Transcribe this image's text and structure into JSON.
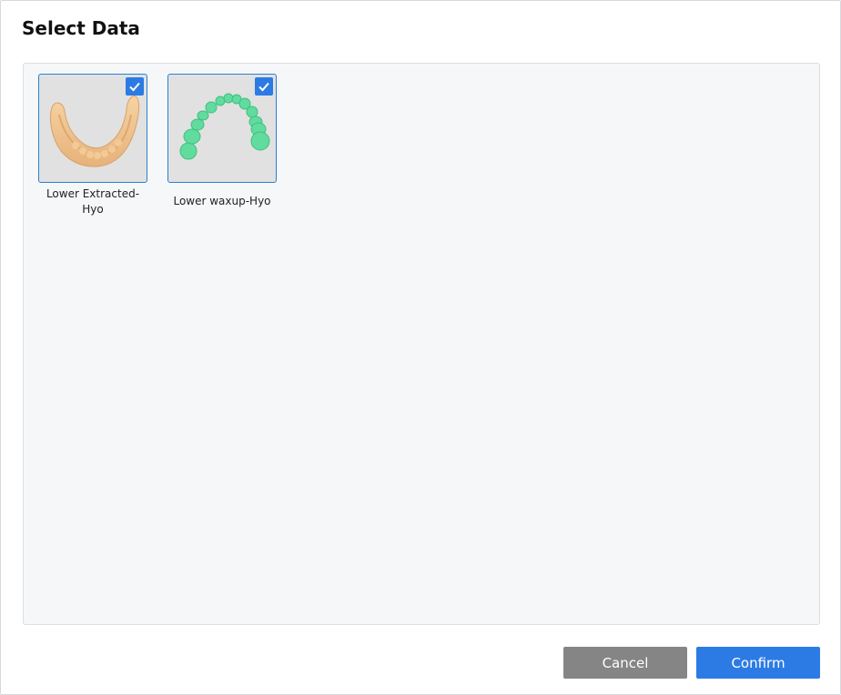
{
  "dialog": {
    "title": "Select Data"
  },
  "items": [
    {
      "label_line1": "Lower Extracted-",
      "label_line2": "Hyo",
      "selected": true,
      "model_color": "#f0c58f",
      "icon": "lower-jaw-model"
    },
    {
      "label_line1": "Lower waxup-Hyo",
      "selected": true,
      "model_color": "#5ed99a",
      "icon": "tooth-arch-model"
    }
  ],
  "buttons": {
    "cancel_label": "Cancel",
    "confirm_label": "Confirm"
  },
  "colors": {
    "accent": "#2c7be5",
    "cancel": "#858585",
    "panel": "#f6f7f9"
  }
}
